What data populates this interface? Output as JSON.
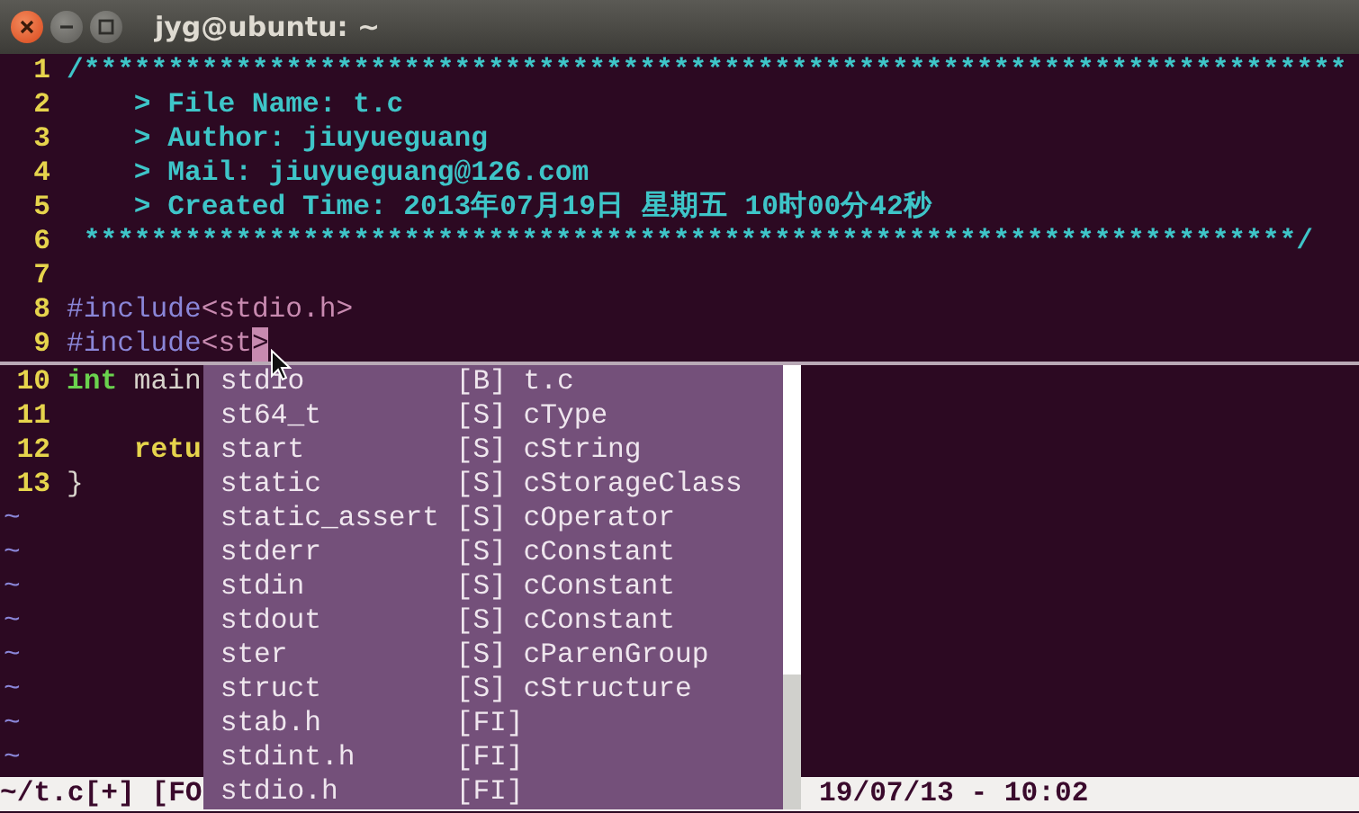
{
  "window": {
    "title": "jyg@ubuntu: ~"
  },
  "editor": {
    "lines": [
      {
        "number": "1",
        "segments": [
          {
            "kind": "comment",
            "text": "/***************************************************************************"
          }
        ]
      },
      {
        "number": "2",
        "segments": [
          {
            "kind": "comment",
            "text": "    > File Name: t.c"
          }
        ]
      },
      {
        "number": "3",
        "segments": [
          {
            "kind": "comment",
            "text": "    > Author: jiuyueguang"
          }
        ]
      },
      {
        "number": "4",
        "segments": [
          {
            "kind": "comment",
            "text": "    > Mail: jiuyueguang@126.com"
          }
        ]
      },
      {
        "number": "5",
        "segments": [
          {
            "kind": "comment",
            "text": "    > Created Time: 2013年07月19日 星期五 10时00分42秒"
          }
        ]
      },
      {
        "number": "6",
        "segments": [
          {
            "kind": "comment",
            "text": " ************************************************************************/"
          }
        ]
      },
      {
        "number": "7"
      },
      {
        "number": "8",
        "segments": [
          {
            "kind": "preproc",
            "text": "#include"
          },
          {
            "kind": "include",
            "text": "<stdio.h>"
          }
        ]
      },
      {
        "number": "9",
        "segments": [
          {
            "kind": "preproc",
            "text": "#include"
          },
          {
            "kind": "include",
            "text": "<st"
          },
          {
            "kind": "cursor",
            "text": ">"
          }
        ]
      },
      {
        "number": "10",
        "segments": [
          {
            "kind": "type",
            "text": "int"
          },
          {
            "kind": "plain",
            "text": " main"
          }
        ]
      },
      {
        "number": "11"
      },
      {
        "number": "12",
        "segments": [
          {
            "kind": "keyword",
            "text": "    retu"
          }
        ]
      },
      {
        "number": "13",
        "segments": [
          {
            "kind": "plain",
            "text": "}"
          }
        ]
      }
    ],
    "filler_lines": [
      "~",
      "~",
      "~",
      "~",
      "~",
      "~",
      "~",
      "~"
    ]
  },
  "completion_menu": {
    "items": [
      {
        "word": "stdio",
        "tag": "[B]",
        "menu": "t.c",
        "selected": false
      },
      {
        "word": "st64_t",
        "tag": "[S]",
        "menu": "cType",
        "selected": false
      },
      {
        "word": "start",
        "tag": "[S]",
        "menu": "cString",
        "selected": false
      },
      {
        "word": "static",
        "tag": "[S]",
        "menu": "cStorageClass",
        "selected": false
      },
      {
        "word": "static_assert",
        "tag": "[S]",
        "menu": "cOperator",
        "selected": false
      },
      {
        "word": "stderr",
        "tag": "[S]",
        "menu": "cConstant",
        "selected": false
      },
      {
        "word": "stdin",
        "tag": "[S]",
        "menu": "cConstant",
        "selected": false
      },
      {
        "word": "stdout",
        "tag": "[S]",
        "menu": "cConstant",
        "selected": false
      },
      {
        "word": "ster",
        "tag": "[S]",
        "menu": "cParenGroup",
        "selected": false
      },
      {
        "word": "struct",
        "tag": "[S]",
        "menu": "cStructure",
        "selected": false
      },
      {
        "word": "stab.h",
        "tag": "[FI]",
        "selected": false
      },
      {
        "word": "stdint.h",
        "tag": "[FI]",
        "selected": false
      },
      {
        "word": "stdio.h",
        "tag": "[FI]",
        "selected": false
      }
    ]
  },
  "status_bar": {
    "left": "~/t.c[+] [FO",
    "right": "19/07/13 - 10:02"
  }
}
